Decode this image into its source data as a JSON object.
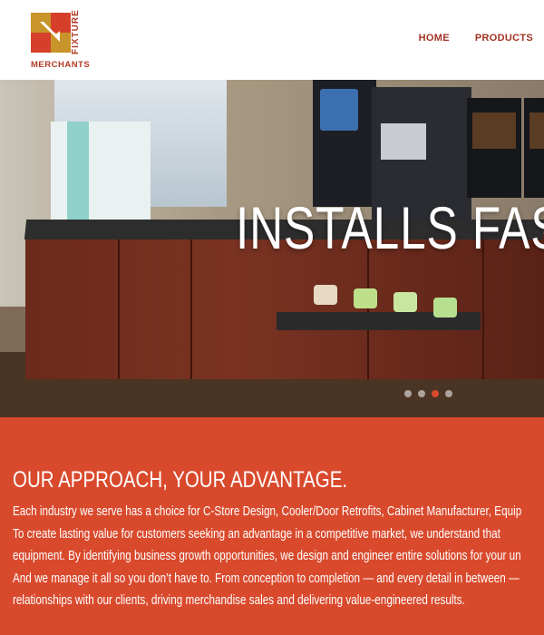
{
  "brand": {
    "logo_word_vertical": "FIXTURE",
    "logo_word_bottom": "MERCHANTS",
    "colors": {
      "red": "#d94a2d",
      "gold": "#c9952a",
      "dark_red": "#a23325"
    }
  },
  "nav": {
    "items": [
      {
        "label": "HOME"
      },
      {
        "label": "PRODUCTS"
      }
    ]
  },
  "hero": {
    "headline": "INSTALLS FAST",
    "slider": {
      "total": 4,
      "active_index": 3
    }
  },
  "approach": {
    "title": "OUR APPROACH, YOUR ADVANTAGE.",
    "lines": [
      "Each industry we serve has a choice for C-Store Design, Cooler/Door Retrofits, Cabinet Manufacturer, Equip",
      "To create lasting value for customers seeking an advantage in a competitive market, we understand that",
      "equipment. By identifying business growth opportunities, we design and engineer entire solutions for your un",
      "And we manage it all so you don’t have to. From conception to completion — and every detail in between —",
      "relationships with our clients, driving merchandise sales and delivering value-engineered results."
    ]
  }
}
